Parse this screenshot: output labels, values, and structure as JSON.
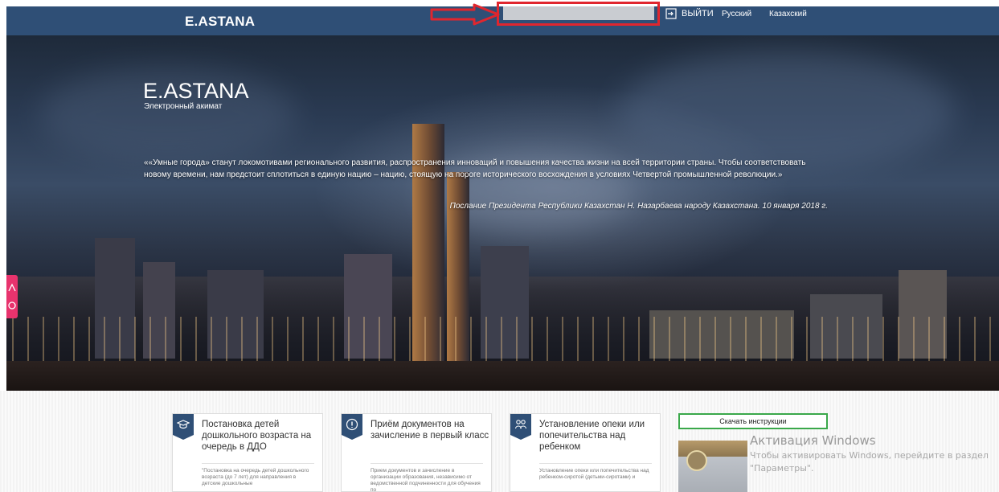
{
  "header": {
    "brand": "E.ASTANA",
    "login_label": "ВЫЙТИ",
    "languages": [
      "Русский",
      "Казахский"
    ]
  },
  "hero": {
    "title": "E.ASTANA",
    "subtitle": "Электронный акимат",
    "quote": "««Умные города» станут локомотивами регионального развития, распространения инноваций и повышения качества жизни на всей территории страны. Чтобы соответствовать новому времени, нам предстоит сплотиться в единую нацию – нацию, стоящую на пороге исторического восхождения в условиях Четвертой промышленной революции.»",
    "quote_source": "Послание Президента Республики Казахстан Н. Назарбаева народу Казахстана. 10 января 2018 г."
  },
  "services": [
    {
      "icon": "graduation-cap-icon",
      "title": "Постановка детей дошкольного возраста на очередь в ДДО",
      "description": "\"Постановка на очередь детей дошкольного возраста (до 7 лет) для направления в детские дошкольные"
    },
    {
      "icon": "info-icon",
      "title": "Приём документов на зачисление в первый класс",
      "description": "Прием документов и зачисление в организации образования, независимо от ведомственной подчиненности для обучения по"
    },
    {
      "icon": "people-icon",
      "title": "Установление опеки или попечительства над ребенком",
      "description": "Установление опеки или попечительства над ребенком-сиротой (детьми-сиротами) и"
    }
  ],
  "download_button": "Скачать инструкции",
  "windows_activation": {
    "title": "Активация Windows",
    "text": "Чтобы активировать Windows, перейдите в раздел \"Параметры\"."
  },
  "colors": {
    "header_bg": "#2f4f76",
    "highlight_red": "#e0262e",
    "download_border": "#3aa84a",
    "side_tab": "#e8336d"
  }
}
